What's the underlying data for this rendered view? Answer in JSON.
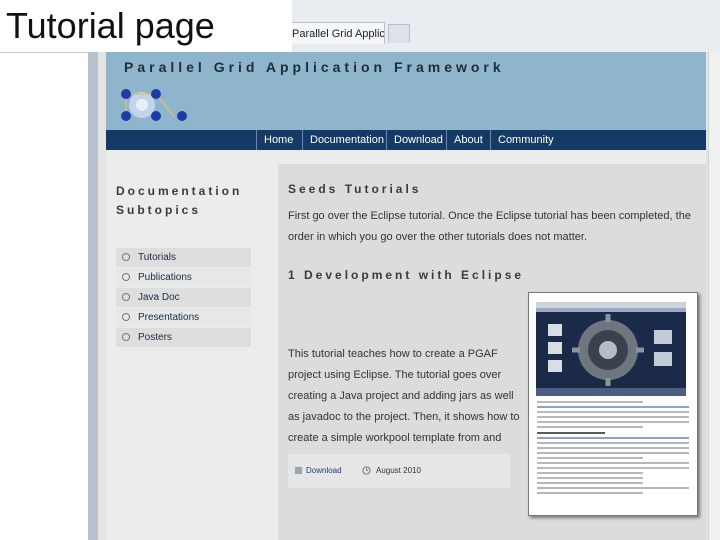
{
  "slide": {
    "title": "Tutorial page"
  },
  "browser": {
    "tab_label": "Parallel Grid Application Framework"
  },
  "site": {
    "title": "Parallel Grid Application Framework",
    "nav": [
      "Home",
      "Documentation",
      "Download",
      "About",
      "Community"
    ],
    "nav_colors": {
      "banner": "#8fb5cc",
      "bar": "#163a66"
    }
  },
  "sidebar": {
    "title_line1": "Documentation",
    "title_line2": "Subtopics",
    "items": [
      "Tutorials",
      "Publications",
      "Java Doc",
      "Presentations",
      "Posters"
    ]
  },
  "main": {
    "title": "Seeds Tutorials",
    "intro": "First go over the Eclipse tutorial. Once the Eclipse tutorial has been completed, the order in which you go over the other tutorials does not matter.",
    "section_heading": "1 Development with Eclipse",
    "body": "This tutorial teaches how to create a PGAF project using Eclipse. The tutorial goes over creating a Java project and adding jars as well as javadoc to the project. Then, it shows how to create a simple workpool template from and run it using Seeds on a Grid.",
    "footer_link": "Download",
    "footer_date": "August 2010"
  }
}
